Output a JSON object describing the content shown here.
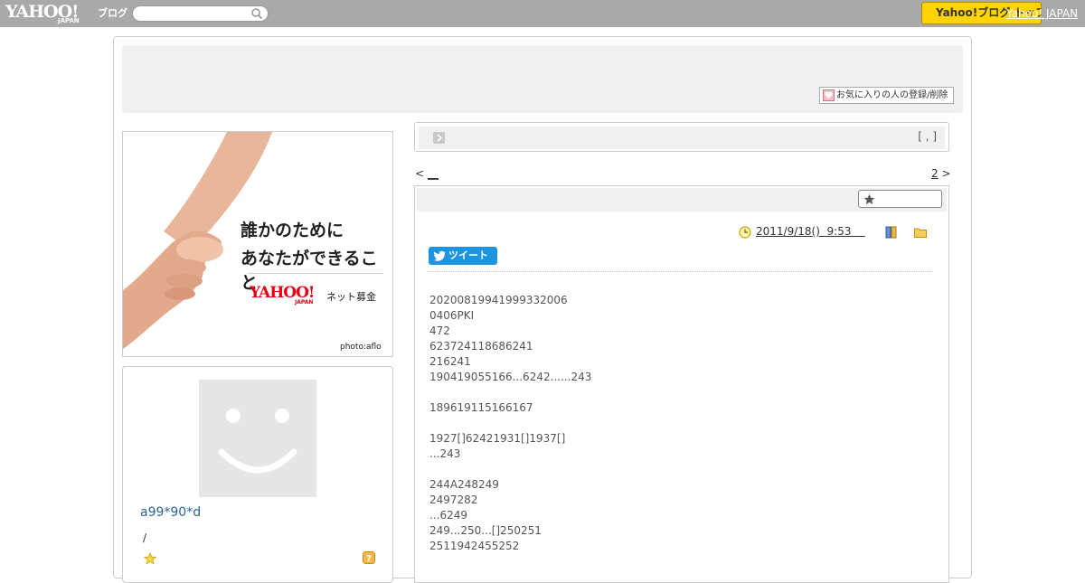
{
  "topbar": {
    "logo_main": "YAHOO!",
    "logo_sub": "JAPAN",
    "logo_blog": "ブログ",
    "search_placeholder": "",
    "yellow_button": "Yahoo!ブログ トップ",
    "top_link": "Yahoo! JAPAN"
  },
  "header": {
    "fav_button": "お気に入りの人の登録/削除"
  },
  "banner": {
    "line1": "誰かのために",
    "line2": "あなたができること",
    "logo": "YAHOO!",
    "logo_sub": "JAPAN",
    "sub": "ネット募金",
    "credit": "photo:aflo"
  },
  "profile": {
    "username": "a99*90*d",
    "slash": "/"
  },
  "titlebox": {
    "bracket": "[ , ]"
  },
  "pager": {
    "prev_arrow": "<",
    "prev_link": "__",
    "next_link": "2",
    "next_arrow": ">"
  },
  "article": {
    "date": "2011/9/18()  9:53    ",
    "tweet": "ツイート",
    "lines": [
      "20200819941999332006",
      "0406PKI",
      "472",
      "623724118686241",
      "216241",
      "190419055166...6242......243",
      "",
      "189619115166167",
      "",
      "1927[]62421931[]1937[]",
      "...243",
      "",
      "244A248249",
      "2497282",
      "...6249",
      "249...250...[]250251",
      "2511942455252"
    ]
  },
  "colors": {
    "topbar": "#a9a9a9",
    "accent_yellow": "#ffd400",
    "tweet_blue": "#1b95e0",
    "link_blue": "#2a6496"
  }
}
